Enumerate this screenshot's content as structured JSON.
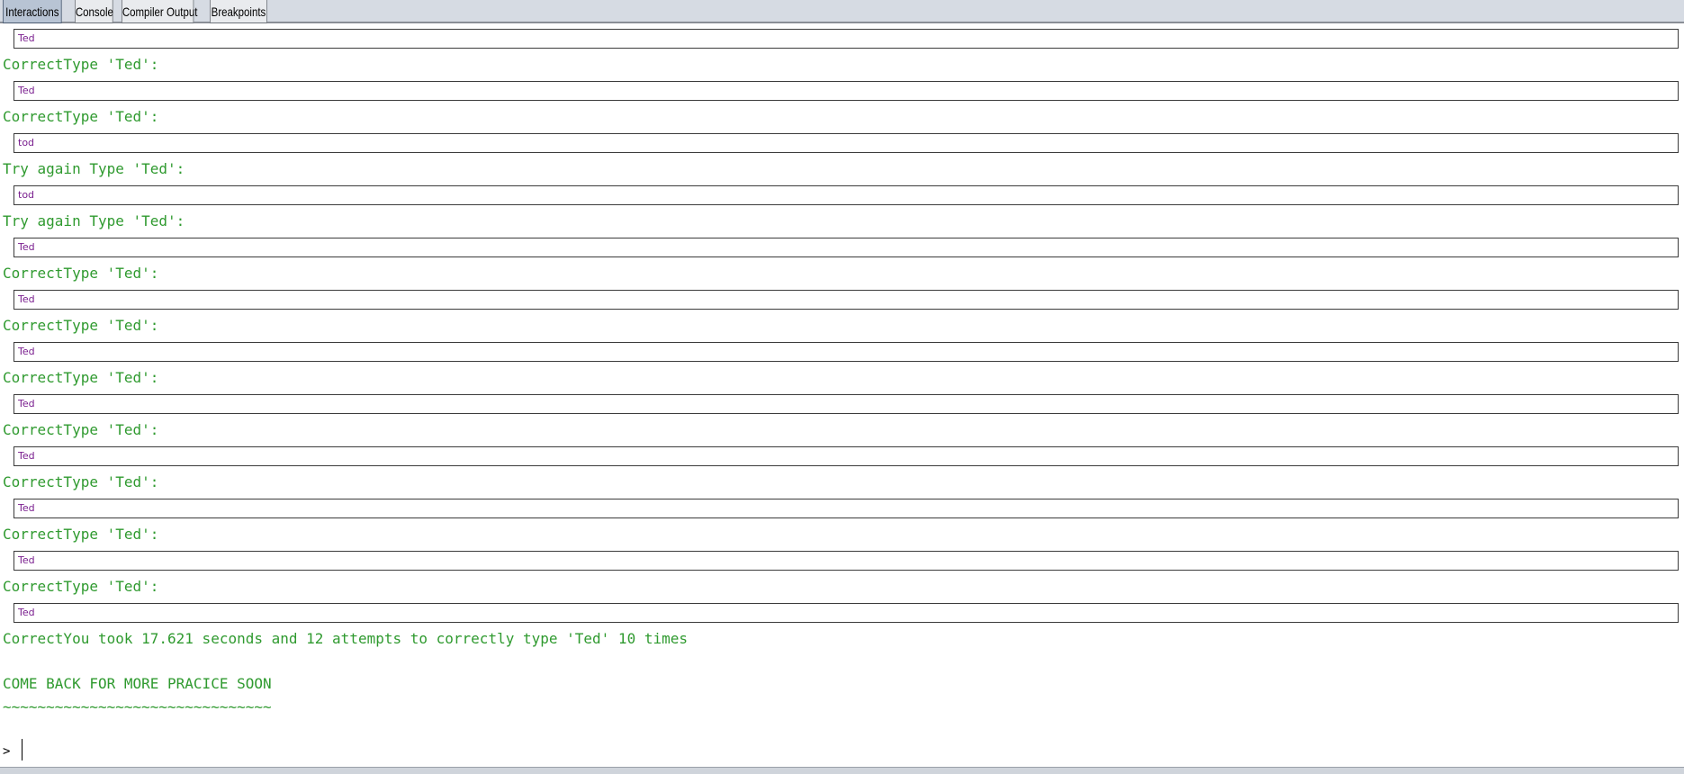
{
  "tabs": [
    {
      "label": "Interactions",
      "active": true
    },
    {
      "label": "Console",
      "active": false
    },
    {
      "label": "Compiler Output",
      "active": false
    },
    {
      "label": "Breakpoints",
      "active": false
    }
  ],
  "transcript": {
    "inputs": [
      "Ted",
      "Ted",
      "tod",
      "tod",
      "Ted",
      "Ted",
      "Ted",
      "Ted",
      "Ted",
      "Ted",
      "Ted",
      "Ted"
    ],
    "outputs": [
      "CorrectType 'Ted':",
      "CorrectType 'Ted':",
      "Try again Type 'Ted':",
      "Try again Type 'Ted':",
      "CorrectType 'Ted':",
      "CorrectType 'Ted':",
      "CorrectType 'Ted':",
      "CorrectType 'Ted':",
      "CorrectType 'Ted':",
      "CorrectType 'Ted':",
      "CorrectType 'Ted':"
    ],
    "summary": "CorrectYou took 17.621 seconds and 12 attempts to correctly type 'Ted' 10 times",
    "farewell": "COME BACK FOR MORE PRACICE SOON",
    "tilde_line": "~~~~~~~~~~~~~~~~~~~~~~~~~~~~~~~",
    "prompt": ">"
  },
  "colors": {
    "output_text": "#2f9a2f",
    "input_text": "#7a1f8f",
    "tab_active": "#b8c4d4"
  }
}
